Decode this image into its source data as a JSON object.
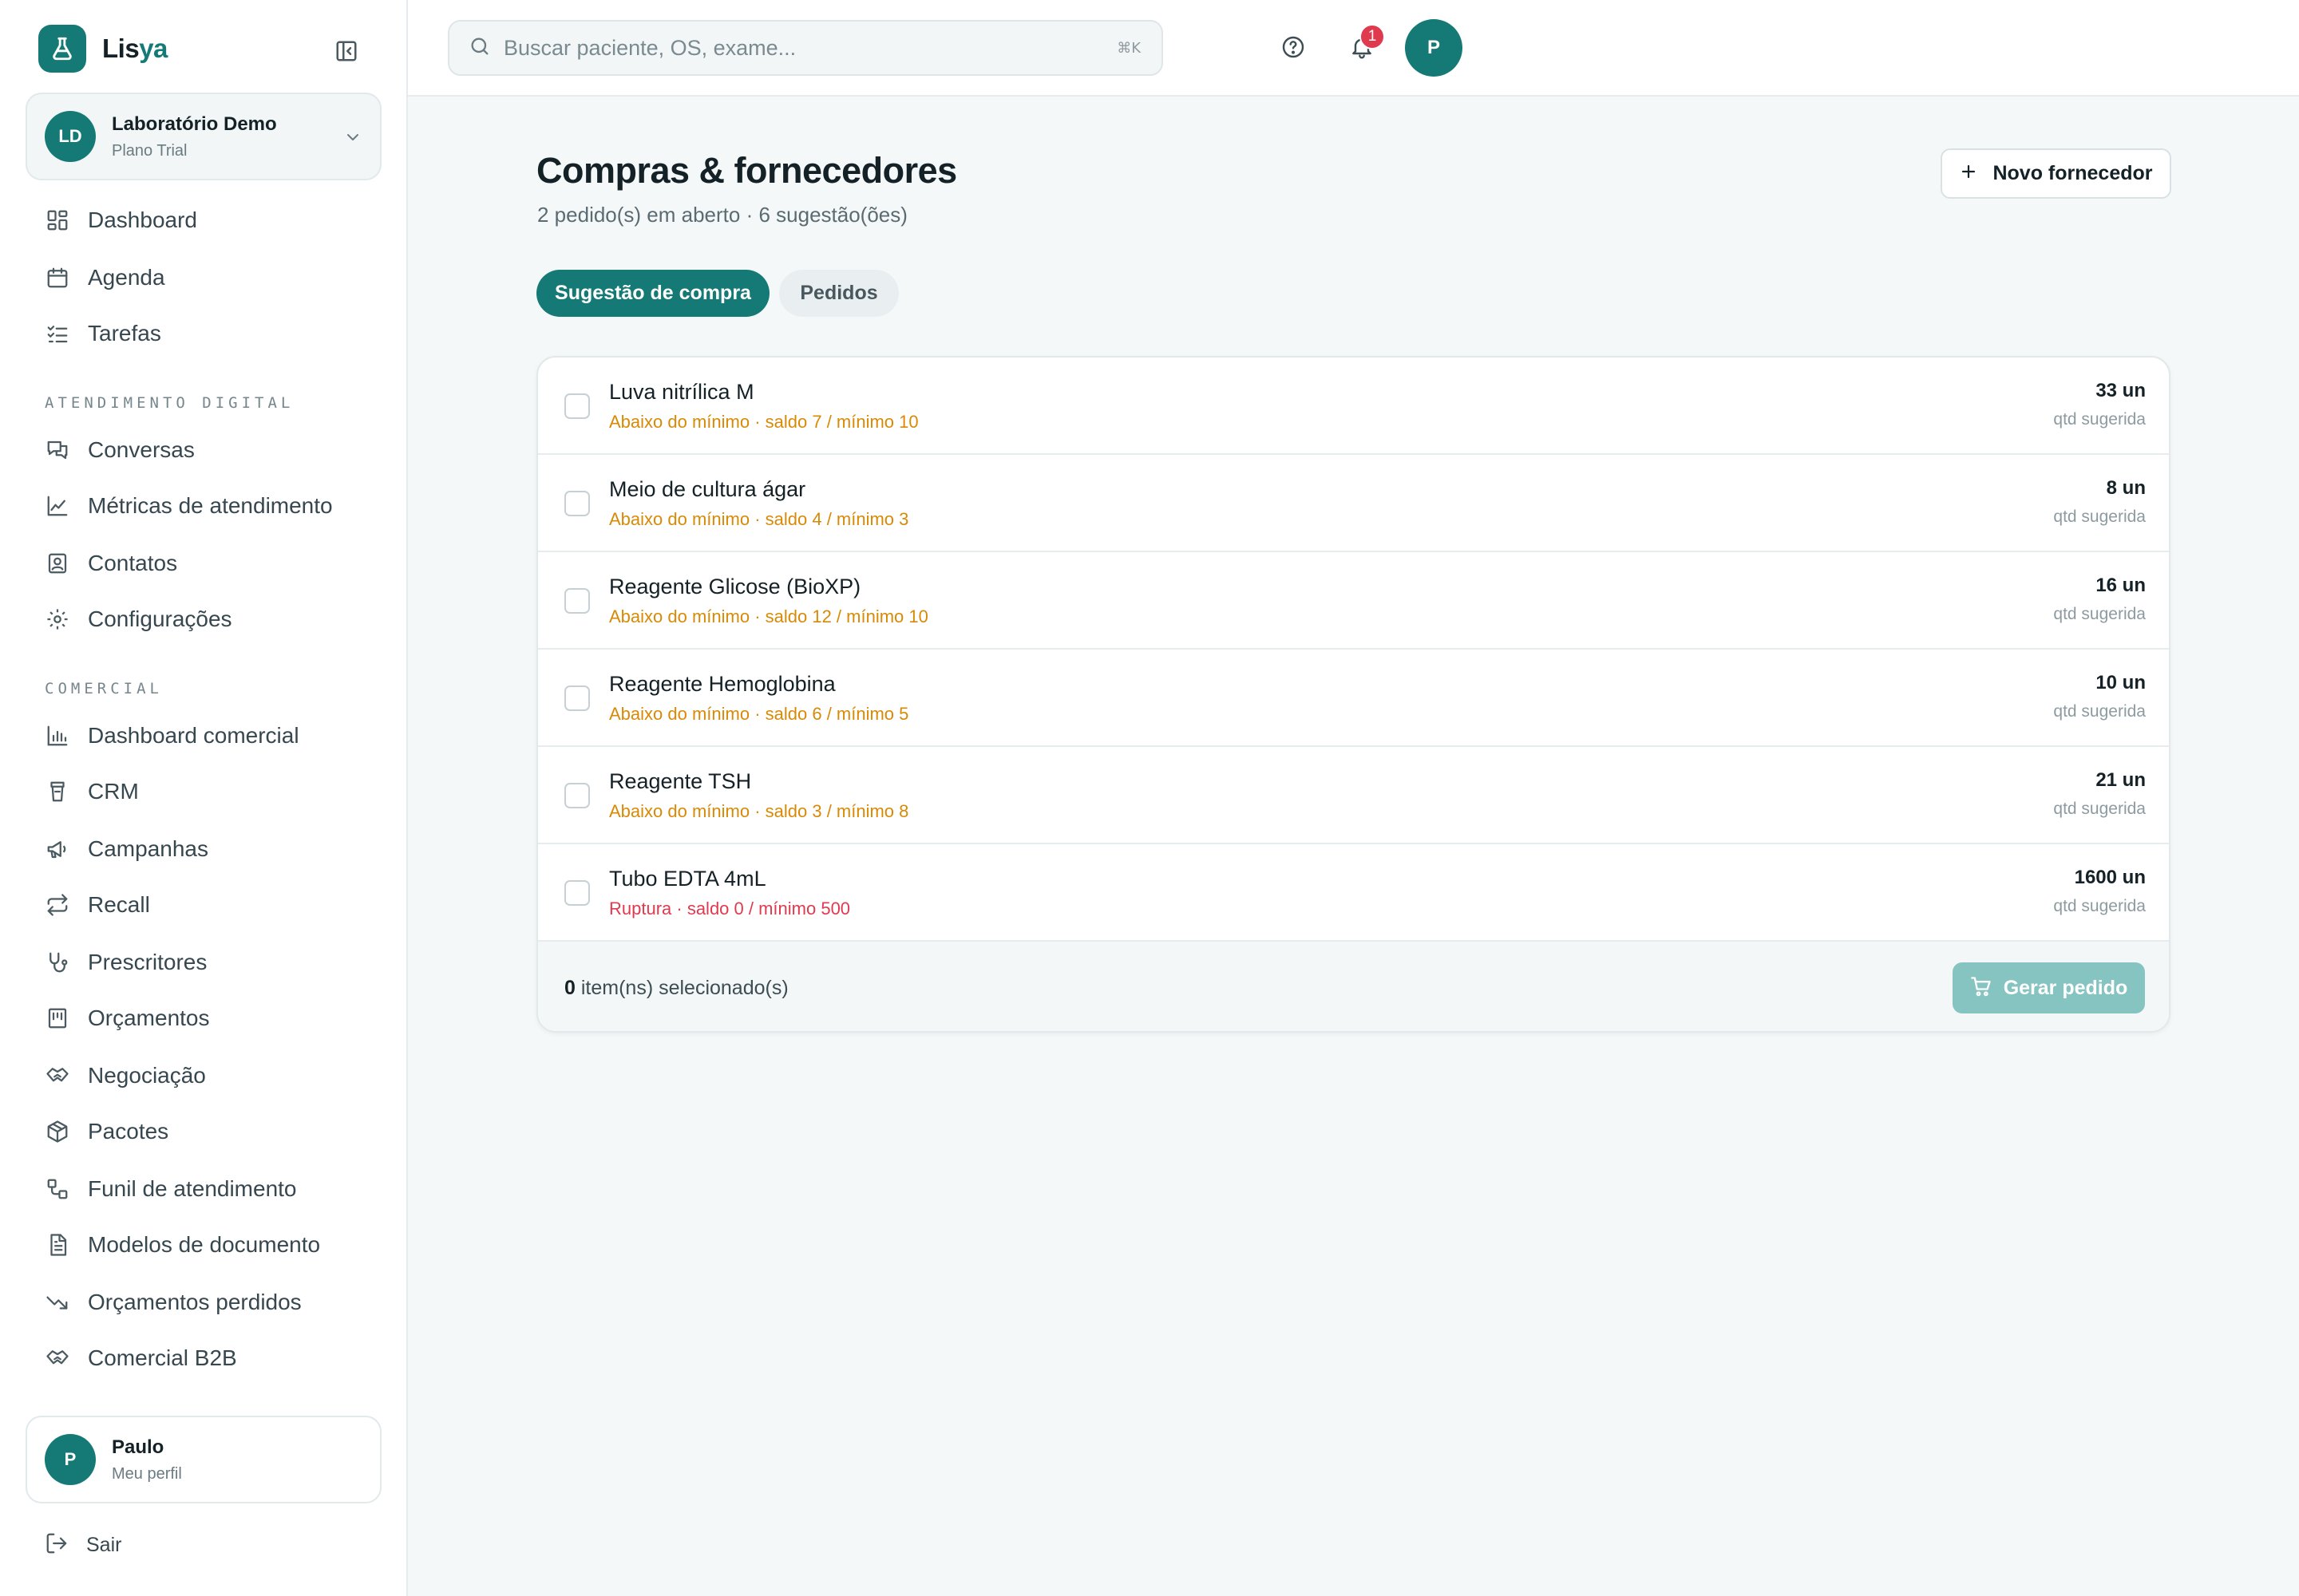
{
  "app": {
    "name_prefix": "Lis",
    "name_accent": "ya",
    "accent_color": "#157a76"
  },
  "organization": {
    "initials": "LD",
    "name": "Laboratório Demo",
    "plan": "Plano Trial"
  },
  "sidebar": {
    "primary": [
      {
        "label": "Dashboard",
        "icon": "dashboard-icon"
      },
      {
        "label": "Agenda",
        "icon": "calendar-icon"
      },
      {
        "label": "Tarefas",
        "icon": "checklist-icon"
      }
    ],
    "section_digital": "ATENDIMENTO DIGITAL",
    "digital": [
      {
        "label": "Conversas",
        "icon": "chat-icon"
      },
      {
        "label": "Métricas de atendimento",
        "icon": "line-chart-icon"
      },
      {
        "label": "Contatos",
        "icon": "contact-card-icon"
      },
      {
        "label": "Configurações",
        "icon": "gear-icon"
      }
    ],
    "section_commercial": "COMERCIAL",
    "commercial": [
      {
        "label": "Dashboard comercial",
        "icon": "bar-chart-icon"
      },
      {
        "label": "CRM",
        "icon": "cup-icon"
      },
      {
        "label": "Campanhas",
        "icon": "megaphone-icon"
      },
      {
        "label": "Recall",
        "icon": "repeat-icon"
      },
      {
        "label": "Prescritores",
        "icon": "stethoscope-icon"
      },
      {
        "label": "Orçamentos",
        "icon": "receipt-icon"
      },
      {
        "label": "Negociação",
        "icon": "handshake-icon"
      },
      {
        "label": "Pacotes",
        "icon": "package-icon"
      },
      {
        "label": "Funil de atendimento",
        "icon": "flow-icon"
      },
      {
        "label": "Modelos de documento",
        "icon": "document-icon"
      },
      {
        "label": "Orçamentos perdidos",
        "icon": "trend-down-icon"
      },
      {
        "label": "Comercial B2B",
        "icon": "handshake-icon"
      }
    ]
  },
  "profile": {
    "initial": "P",
    "name": "Paulo",
    "subtitle": "Meu perfil"
  },
  "logout_label": "Sair",
  "header": {
    "search_placeholder": "Buscar paciente, OS, exame...",
    "search_shortcut": "⌘K",
    "notification_count": "1",
    "user_initial": "P"
  },
  "page": {
    "title": "Compras & fornecedores",
    "subtitle": "2 pedido(s) em aberto · 6 sugestão(ões)",
    "new_supplier_label": "Novo fornecedor",
    "tabs": [
      {
        "label": "Sugestão de compra",
        "active": true
      },
      {
        "label": "Pedidos",
        "active": false
      }
    ]
  },
  "suggestions": {
    "items": [
      {
        "name": "Luva nitrílica M",
        "status": "Abaixo do mínimo · saldo 7 / mínimo 10",
        "severity": "warning",
        "qty": "33 un",
        "qty_label": "qtd sugerida"
      },
      {
        "name": "Meio de cultura ágar",
        "status": "Abaixo do mínimo · saldo 4 / mínimo 3",
        "severity": "warning",
        "qty": "8 un",
        "qty_label": "qtd sugerida"
      },
      {
        "name": "Reagente Glicose (BioXP)",
        "status": "Abaixo do mínimo · saldo 12 / mínimo 10",
        "severity": "warning",
        "qty": "16 un",
        "qty_label": "qtd sugerida"
      },
      {
        "name": "Reagente Hemoglobina",
        "status": "Abaixo do mínimo · saldo 6 / mínimo 5",
        "severity": "warning",
        "qty": "10 un",
        "qty_label": "qtd sugerida"
      },
      {
        "name": "Reagente TSH",
        "status": "Abaixo do mínimo · saldo 3 / mínimo 8",
        "severity": "warning",
        "qty": "21 un",
        "qty_label": "qtd sugerida"
      },
      {
        "name": "Tubo EDTA 4mL",
        "status": "Ruptura · saldo 0 / mínimo 500",
        "severity": "danger",
        "qty": "1600 un",
        "qty_label": "qtd sugerida"
      }
    ],
    "selected_count": "0",
    "selected_suffix": "item(ns) selecionado(s)",
    "generate_label": "Gerar pedido"
  },
  "colors": {
    "warning": "#d88a06",
    "danger": "#e03a4e",
    "primary": "#157a76",
    "primary_disabled": "#86c4c1"
  }
}
